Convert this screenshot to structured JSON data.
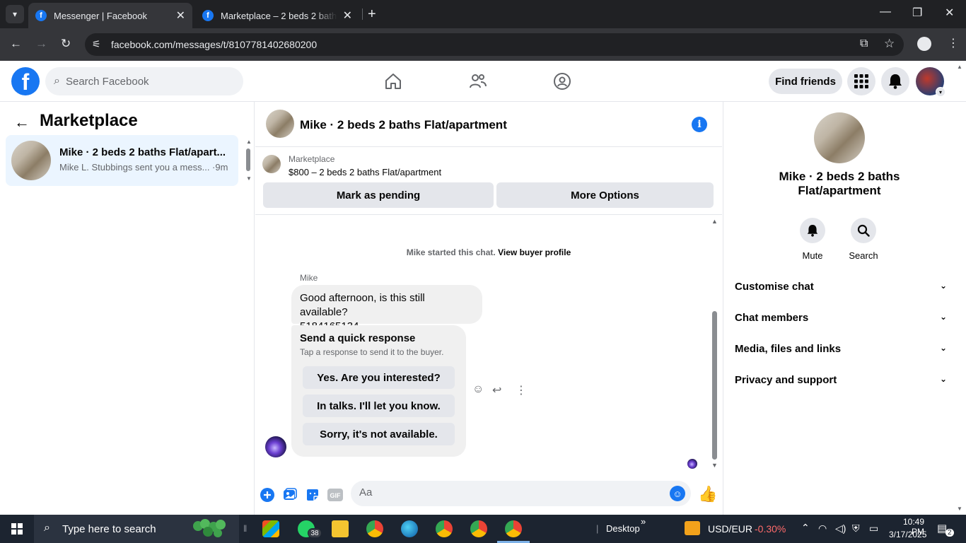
{
  "browser": {
    "tabs": [
      {
        "title": "Messenger | Facebook",
        "active": true
      },
      {
        "title": "Marketplace – 2 beds 2 baths Fl",
        "active": false
      }
    ],
    "url": "facebook.com/messages/t/8107781402680200"
  },
  "header": {
    "search_placeholder": "Search Facebook",
    "find_friends": "Find friends"
  },
  "left": {
    "title": "Marketplace",
    "conversation": {
      "name": "Mike · 2 beds 2 baths Flat/apart...",
      "snippet": "Mike L. Stubbings sent you a mess... ·9m"
    }
  },
  "chat": {
    "title": "Mike · 2 beds 2 baths Flat/apartment",
    "marketplace_label": "Marketplace",
    "listing": "$800 – 2 beds 2 baths Flat/apartment",
    "mark_pending": "Mark as pending",
    "more_options": "More Options",
    "started_text": "Mike started this chat.",
    "view_buyer": "View buyer profile",
    "sender": "Mike",
    "message_line1": "Good afternoon, is this still available?",
    "message_line2": "5184165134",
    "quick_title": "Send a quick response",
    "quick_sub": "Tap a response to send it to the buyer.",
    "quick_replies": [
      "Yes. Are you interested?",
      "In talks. I'll let you know.",
      "Sorry, it's not available."
    ],
    "composer_placeholder": "Aa"
  },
  "right": {
    "name": "Mike · 2 beds 2 baths Flat/apartment",
    "mute": "Mute",
    "search": "Search",
    "sections": [
      "Customise chat",
      "Chat members",
      "Media, files and links",
      "Privacy and support"
    ]
  },
  "taskbar": {
    "search_placeholder": "Type here to search",
    "whatsapp_badge": "38",
    "desktop": "Desktop",
    "currency": "USD/EUR",
    "currency_change": "-0.30%",
    "time": "10:49 PM",
    "date": "3/17/2025",
    "notifications": "2"
  },
  "colors": {
    "brand": "#1877f2",
    "selected_bg": "#ebf5ff",
    "negative": "#ff6b6b"
  }
}
